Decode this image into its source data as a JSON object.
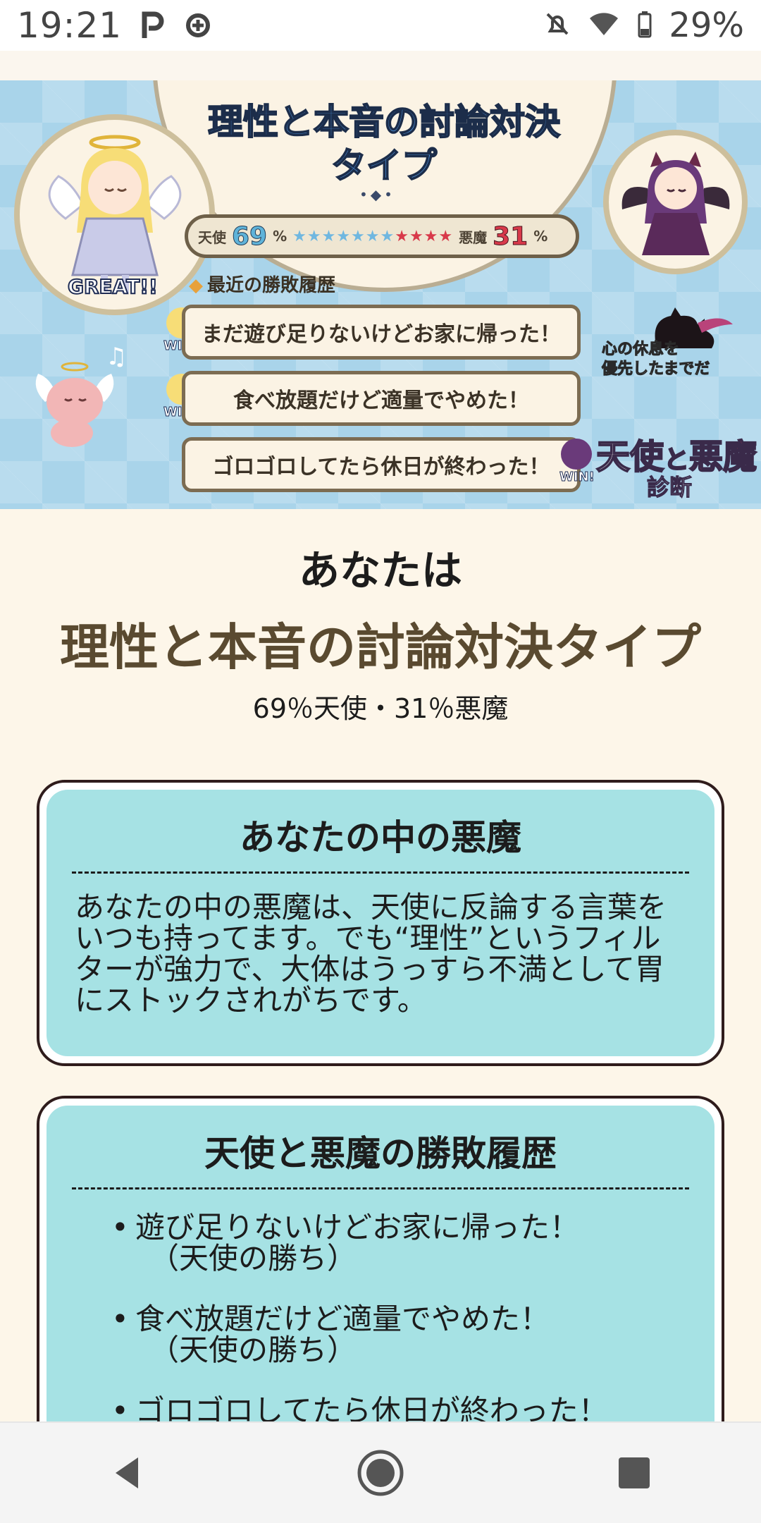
{
  "status_bar": {
    "time": "19:21",
    "battery": "29%",
    "icons": [
      "parking-icon",
      "data-saver-icon",
      "notifications-off-icon",
      "wifi-icon",
      "battery-icon"
    ]
  },
  "banner": {
    "title_line1": "理性と本音の討論対決",
    "title_line2": "タイプ",
    "great": "GREAT!!",
    "score": {
      "angel_label": "天使",
      "angel_pct": "69",
      "devil_label": "悪魔",
      "devil_pct": "31",
      "unit": "%",
      "angel_stars": "★★★★★★★",
      "devil_stars": "★★★★"
    },
    "recent_label": "最近の勝敗履歴",
    "history": [
      {
        "text": "まだ遊び足りないけどお家に帰った！",
        "win": "WIN!"
      },
      {
        "text": "食べ放題だけど適量でやめた！",
        "win": "WIN!"
      },
      {
        "text": "ゴロゴロしてたら休日が終わった！",
        "win": "WIN!"
      }
    ],
    "devil_speech_line1": "心の休息を",
    "devil_speech_line2": "優先したまでだ",
    "logo_angel": "天使",
    "logo_to": "と",
    "logo_devil": "悪魔",
    "logo_sub": "診断"
  },
  "result": {
    "anatawa": "あなたは",
    "type_title": "理性と本音の討論対決タイプ",
    "ratio": "69％天使・31％悪魔"
  },
  "card_devil": {
    "title": "あなたの中の悪魔",
    "body": "あなたの中の悪魔は、天使に反論する言葉をいつも持ってます。でも“理性”というフィルターが強力で、大体はうっすら不満として胃にストックされがちです。"
  },
  "card_history": {
    "title": "天使と悪魔の勝敗履歴",
    "items": [
      {
        "text": "遊び足りないけどお家に帰った！",
        "result": "（天使の勝ち）"
      },
      {
        "text": "食べ放題だけど適量でやめた！",
        "result": "（天使の勝ち）"
      },
      {
        "text": "ゴロゴロしてたら休日が終わった！",
        "result": ""
      }
    ]
  },
  "colors": {
    "banner_bg": "#a9d4ea",
    "page_bg": "#fdf6e9",
    "card_bg": "#a6e2e4",
    "angel_accent": "#5fb3d9",
    "devil_accent": "#d8394a",
    "title_brown": "#5a4a30"
  }
}
